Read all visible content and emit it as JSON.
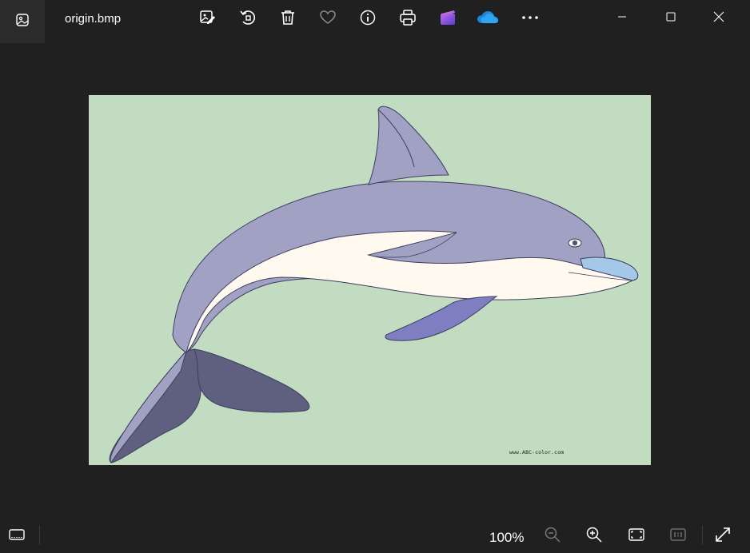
{
  "titlebar": {
    "filename": "origin.bmp",
    "toolbar": [
      {
        "name": "edit-image-icon",
        "label": "Edit image"
      },
      {
        "name": "rotate-icon",
        "label": "Rotate"
      },
      {
        "name": "delete-icon",
        "label": "Delete"
      },
      {
        "name": "favorite-icon",
        "label": "Favorite"
      },
      {
        "name": "info-icon",
        "label": "File information"
      },
      {
        "name": "print-icon",
        "label": "Print"
      },
      {
        "name": "clipchamp-icon",
        "label": "Clipchamp"
      },
      {
        "name": "onedrive-icon",
        "label": "OneDrive"
      },
      {
        "name": "more-icon",
        "label": "See more"
      }
    ],
    "window_buttons": [
      "minimize",
      "maximize",
      "close"
    ]
  },
  "image": {
    "watermark": "www.ABC-color.com"
  },
  "statusbar": {
    "zoom_level": "100%",
    "filmstrip_label": "Filmstrip",
    "zoom_out_label": "Zoom out",
    "zoom_in_label": "Zoom in",
    "fit_label": "Fit to window",
    "actual_size_label": "1:1",
    "fullscreen_label": "Full screen"
  },
  "colors": {
    "background": "#202020",
    "photo_background": "#c2dcc2",
    "dolphin_body": "#a1a1c3",
    "dolphin_belly": "#fff9f0",
    "dolphin_flipper": "#7e7ec0",
    "dolphin_tail": "#5f5f80",
    "dolphin_snout": "#a4c8e8"
  }
}
